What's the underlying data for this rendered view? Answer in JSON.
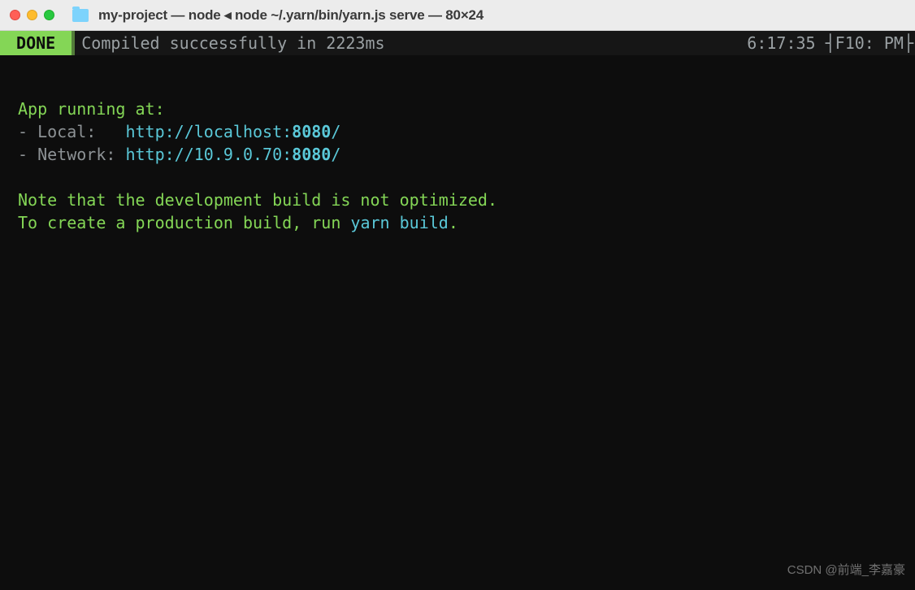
{
  "titlebar": {
    "title": "my-project — node ◂ node ~/.yarn/bin/yarn.js serve — 80×24"
  },
  "status": {
    "badge": " DONE ",
    "message": "Compiled successfully in 2223ms",
    "clock": "6:17:35 ┤F10: PM├"
  },
  "output": {
    "running_at": "App running at:",
    "local_prefix": "- Local:   ",
    "local_url_base": "http://localhost:",
    "local_port": "8080",
    "local_url_tail": "/",
    "network_prefix": "- Network: ",
    "network_url_base": "http://10.9.0.70:",
    "network_port": "8080",
    "network_url_tail": "/",
    "note_line1": "Note that the development build is not optimized.",
    "note_line2a": "To create a production build, run ",
    "yarn_build": "yarn build",
    "note_line2b": "."
  },
  "watermark": "CSDN @前端_李嘉豪"
}
